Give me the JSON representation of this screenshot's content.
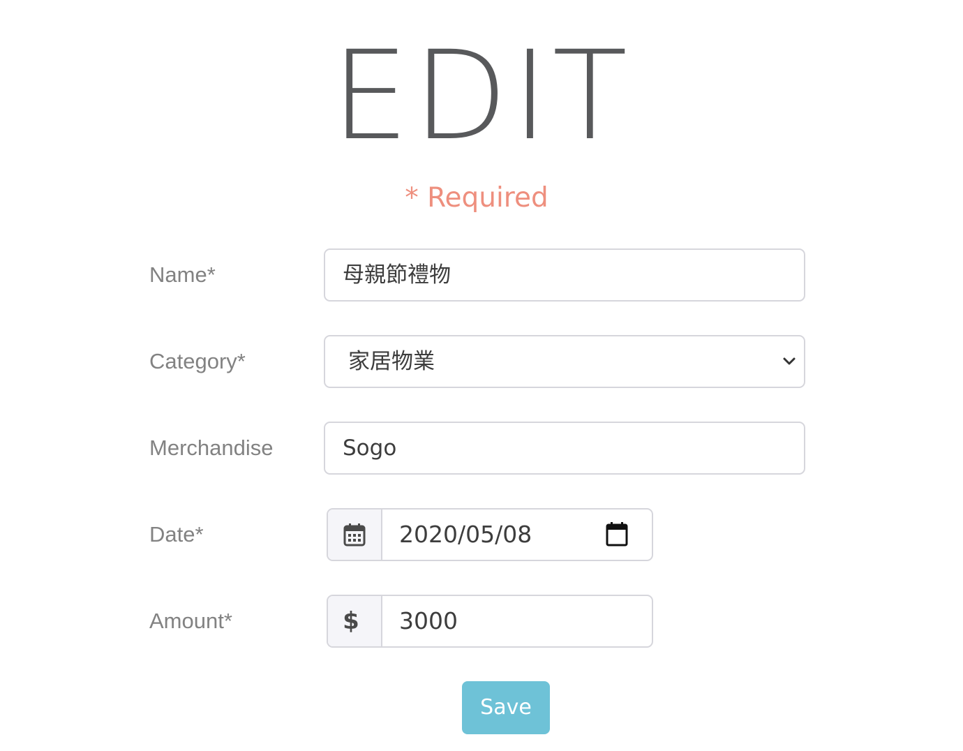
{
  "header": {
    "title": "EDIT",
    "required_note": "* Required"
  },
  "form": {
    "name": {
      "label": "Name*",
      "value": "母親節禮物"
    },
    "category": {
      "label": "Category*",
      "selected": "家居物業"
    },
    "merchandise": {
      "label": "Merchandise",
      "value": "Sogo"
    },
    "date": {
      "label": "Date*",
      "value": "2020/05/08"
    },
    "amount": {
      "label": "Amount*",
      "currency_symbol": "$",
      "value": "3000"
    }
  },
  "actions": {
    "save_label": "Save"
  },
  "colors": {
    "title": "#58595b",
    "required": "#ee8f7e",
    "label": "#828282",
    "save_button": "#6ec2d7"
  }
}
